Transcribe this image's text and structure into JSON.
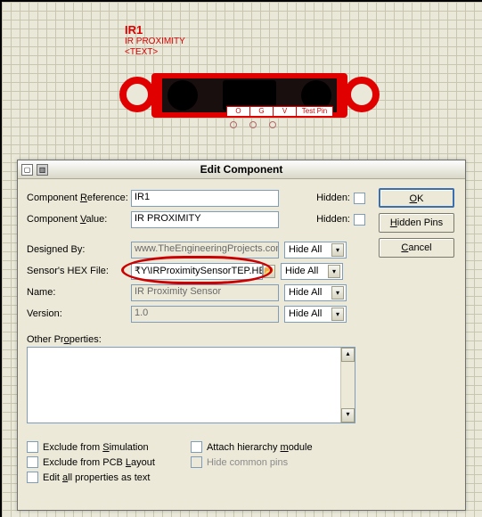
{
  "component": {
    "ref": "IR1",
    "type": "IR PROXIMITY",
    "text_placeholder": "<TEXT>",
    "board_url": "www.TheEngineeringProjects.com",
    "pins": {
      "o": "O",
      "g": "G",
      "v": "V",
      "test": "Test Pin"
    }
  },
  "dialog": {
    "title": "Edit Component",
    "labels": {
      "ref": "Component Reference:",
      "val": "Component Value:",
      "designed": "Designed By:",
      "hex": "Sensor's HEX File:",
      "name": "Name:",
      "version": "Version:",
      "other": "Other Properties:",
      "hidden": "Hidden:"
    },
    "values": {
      "ref": "IR1",
      "val": "IR PROXIMITY",
      "designed": "www.TheEngineeringProjects.com",
      "hex": "₹Y\\IRProximitySensorTEP.HEX",
      "name": "IR Proximity Sensor",
      "version": "1.0",
      "combo": "Hide All"
    },
    "checks": {
      "ex_sim": "Exclude from Simulation",
      "ex_pcb": "Exclude from PCB Layout",
      "edit_all": "Edit all properties as text",
      "attach": "Attach hierarchy module",
      "hide_pins": "Hide common pins"
    },
    "buttons": {
      "ok": "OK",
      "hidden_pins": "Hidden Pins",
      "cancel": "Cancel"
    }
  }
}
